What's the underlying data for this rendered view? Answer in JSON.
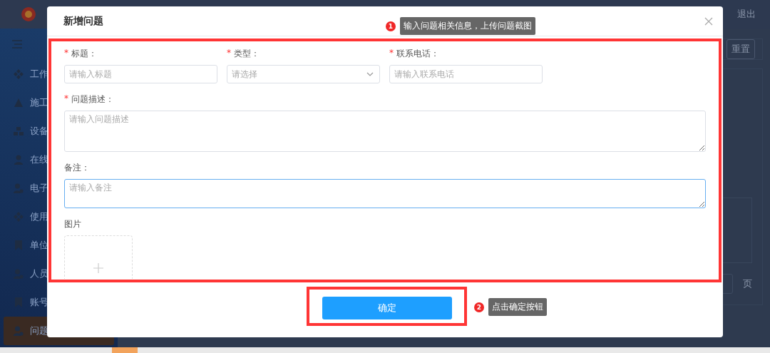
{
  "app": {
    "header": {
      "logout": "退出"
    },
    "sidebar": {
      "items": [
        {
          "label": "工作",
          "selected": false
        },
        {
          "label": "施工",
          "selected": false
        },
        {
          "label": "设备",
          "selected": false
        },
        {
          "label": "在线",
          "selected": false
        },
        {
          "label": "电子",
          "selected": false
        },
        {
          "label": "使用",
          "selected": false
        },
        {
          "label": "单位",
          "selected": false
        },
        {
          "label": "人员",
          "selected": false
        },
        {
          "label": "账号",
          "selected": false
        },
        {
          "label": "问题",
          "selected": true
        }
      ]
    },
    "content": {
      "reset_button": "重置",
      "page_label": "页"
    }
  },
  "dialog": {
    "title": "新增问题",
    "fields": [
      {
        "kind": "input",
        "required_mark": "*",
        "label": "标题：",
        "placeholder": "请输入标题",
        "focused": false
      },
      {
        "kind": "select",
        "required_mark": "*",
        "label": "类型：",
        "placeholder": "请选择",
        "focused": false
      },
      {
        "kind": "input",
        "required_mark": "*",
        "label": "联系电话：",
        "placeholder": "请输入联系电话",
        "focused": false
      },
      {
        "kind": "textarea",
        "required_mark": "*",
        "label": "问题描述：",
        "placeholder": "请输入问题描述",
        "focused": false
      },
      {
        "kind": "textarea",
        "label": "备注：",
        "placeholder": "请输入备注",
        "focused": true
      },
      {
        "kind": "upload",
        "label": "图片"
      }
    ],
    "confirm_button": "确定"
  },
  "annotations": [
    {
      "number": "1",
      "text": "输入问题相关信息，上传问题截图"
    },
    {
      "number": "2",
      "text": "点击确定按钮"
    }
  ]
}
